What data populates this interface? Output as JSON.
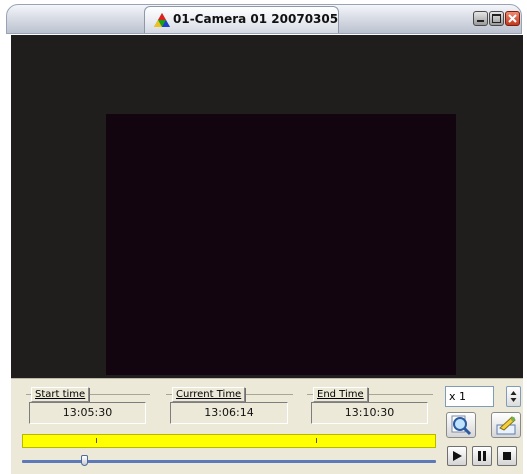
{
  "window": {
    "title": "01-Camera 01  20070305"
  },
  "times": {
    "start_label": "Start time",
    "start_value": "13:05:30",
    "current_label": "Current Time",
    "current_value": "13:06:14",
    "end_label": "End Time",
    "end_value": "13:10:30"
  },
  "playback": {
    "speed": "x 1",
    "slider_position": 0.15
  },
  "icons": {
    "app": "rgb-triangle-icon",
    "minimize": "minimize-icon",
    "maximize": "maximize-icon",
    "close": "close-icon",
    "spin": "up-down-arrows-icon",
    "search": "magnifier-icon",
    "snapshot": "snapshot-icon",
    "play": "play-icon",
    "pause": "pause-icon",
    "stop": "stop-icon"
  },
  "colors": {
    "timeline": "#ffff00",
    "video_background": "#1f1e1d",
    "video_frame": "#120510",
    "close_button": "#c0381c"
  }
}
